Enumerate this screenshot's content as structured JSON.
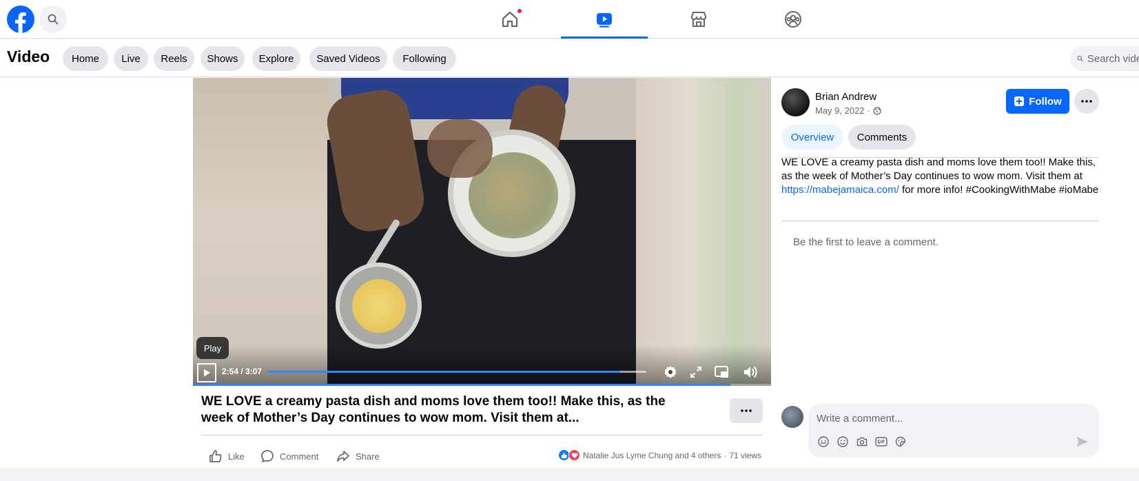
{
  "colors": {
    "brand": "#0866ff",
    "notification": "#e41e3f",
    "like": "#1877f2",
    "love": "#f33e58"
  },
  "topnav": {
    "logo_icon": "facebook-logo-icon",
    "search_icon": "search-icon",
    "tabs": [
      {
        "name": "home",
        "icon": "home-icon",
        "active": false,
        "has_notification": true
      },
      {
        "name": "video",
        "icon": "video-icon",
        "active": true,
        "has_notification": false
      },
      {
        "name": "marketplace",
        "icon": "marketplace-icon",
        "active": false,
        "has_notification": false
      },
      {
        "name": "groups",
        "icon": "groups-icon",
        "active": false,
        "has_notification": false
      }
    ]
  },
  "subnav": {
    "title": "Video",
    "pills": [
      "Home",
      "Live",
      "Reels",
      "Shows",
      "Explore",
      "Saved Videos",
      "Following"
    ],
    "search_placeholder": "Search videos"
  },
  "player": {
    "tooltip": "Play",
    "time": "2:54 / 3:07",
    "progress": 0.93,
    "icons": [
      "play-icon",
      "settings-icon",
      "fullscreen-icon",
      "pip-icon",
      "volume-icon"
    ]
  },
  "post": {
    "caption": "WE LOVE a creamy pasta dish and moms love them too!! Make this, as the week of Mother’s Day continues to wow mom. Visit them at...",
    "actions": {
      "like": "Like",
      "comment": "Comment",
      "share": "Share"
    },
    "reactions_text": "Natalie Jus Lyme Chung and 4 others",
    "views": "71 views",
    "separator": "·"
  },
  "sidebar": {
    "author": "Brian Andrew",
    "date": "May 9, 2022 ·",
    "follow_label": "Follow",
    "tabs": {
      "overview": "Overview",
      "comments": "Comments"
    },
    "description": {
      "text1": "WE LOVE a creamy pasta dish and moms love them too!! Make this, as the week of Mother’s Day continues to wow mom. Visit them at ",
      "link": "https://mabejamaica.com/",
      "text2": " for more info! ",
      "tag1": "#CookingWithMabe",
      "tag2": "#ioMabe"
    },
    "empty_comments": "Be the first to leave a comment.",
    "comment_placeholder": "Write a comment..."
  }
}
